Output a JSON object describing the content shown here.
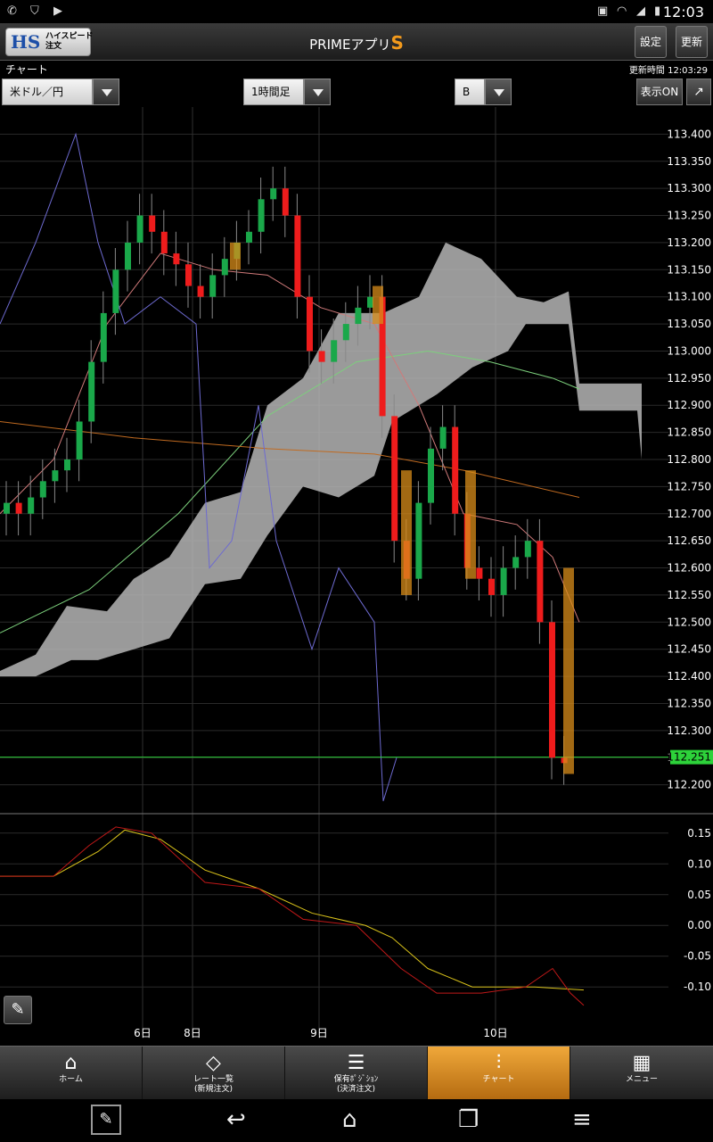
{
  "status_bar": {
    "time": "12:03"
  },
  "app_bar": {
    "logo_text": "HS",
    "logo_sub": "ハイスピード\n注文",
    "title": "PRIMEアプリ",
    "title_accent": "S",
    "settings_label": "設定",
    "refresh_label": "更新"
  },
  "sub_bar": {
    "chart_label": "チャート",
    "update_time": "更新時間 12:03:29"
  },
  "controls": {
    "currency_pair": "米ドル／円",
    "timeframe": "1時間足",
    "side": "B",
    "display_toggle": "表示ON"
  },
  "colors": {
    "up": "#1aa84a",
    "down": "#ee1c1c",
    "cloud": "#b5b5b5",
    "current_price": "#2dd23a",
    "highlight_bar": "#d88c1a"
  },
  "chart_data": {
    "type": "candlestick",
    "price_axis": {
      "ylim": [
        112.15,
        113.45
      ],
      "ticks": [
        "113.400",
        "113.350",
        "113.300",
        "113.250",
        "113.200",
        "113.150",
        "113.100",
        "113.050",
        "113.000",
        "112.950",
        "112.900",
        "112.850",
        "112.800",
        "112.750",
        "112.700",
        "112.650",
        "112.600",
        "112.550",
        "112.500",
        "112.450",
        "112.400",
        "112.350",
        "112.300",
        "112.250",
        "112.200"
      ]
    },
    "current_price": 112.251,
    "current_price_label": "112.251",
    "x_labels": [
      "6日",
      "8日",
      "9日",
      "10日"
    ],
    "oscillator_axis": {
      "ylim": [
        -0.12,
        0.17
      ],
      "ticks": [
        "0.15",
        "0.10",
        "0.05",
        "0.00",
        "-0.05",
        "-0.10"
      ]
    },
    "candles_close_approx": [
      112.72,
      112.7,
      112.73,
      112.76,
      112.78,
      112.8,
      112.87,
      112.98,
      113.07,
      113.15,
      113.2,
      113.25,
      113.22,
      113.18,
      113.16,
      113.12,
      113.1,
      113.14,
      113.17,
      113.2,
      113.22,
      113.28,
      113.3,
      113.25,
      113.1,
      113.0,
      112.98,
      113.02,
      113.05,
      113.08,
      113.1,
      112.88,
      112.65,
      112.58,
      112.72,
      112.82,
      112.86,
      112.7,
      112.6,
      112.58,
      112.55,
      112.6,
      112.62,
      112.65,
      112.5,
      112.25,
      112.24
    ]
  },
  "bottom_nav": [
    {
      "label": "ホーム",
      "icon": "home-icon"
    },
    {
      "label": "レート一覧\n(新規注文)",
      "icon": "rate-list-icon"
    },
    {
      "label": "保有ﾎﾟｼﾞｼｮﾝ\n(決済注文)",
      "icon": "positions-icon"
    },
    {
      "label": "チャート",
      "icon": "chart-icon"
    },
    {
      "label": "メニュー",
      "icon": "menu-grid-icon"
    }
  ]
}
